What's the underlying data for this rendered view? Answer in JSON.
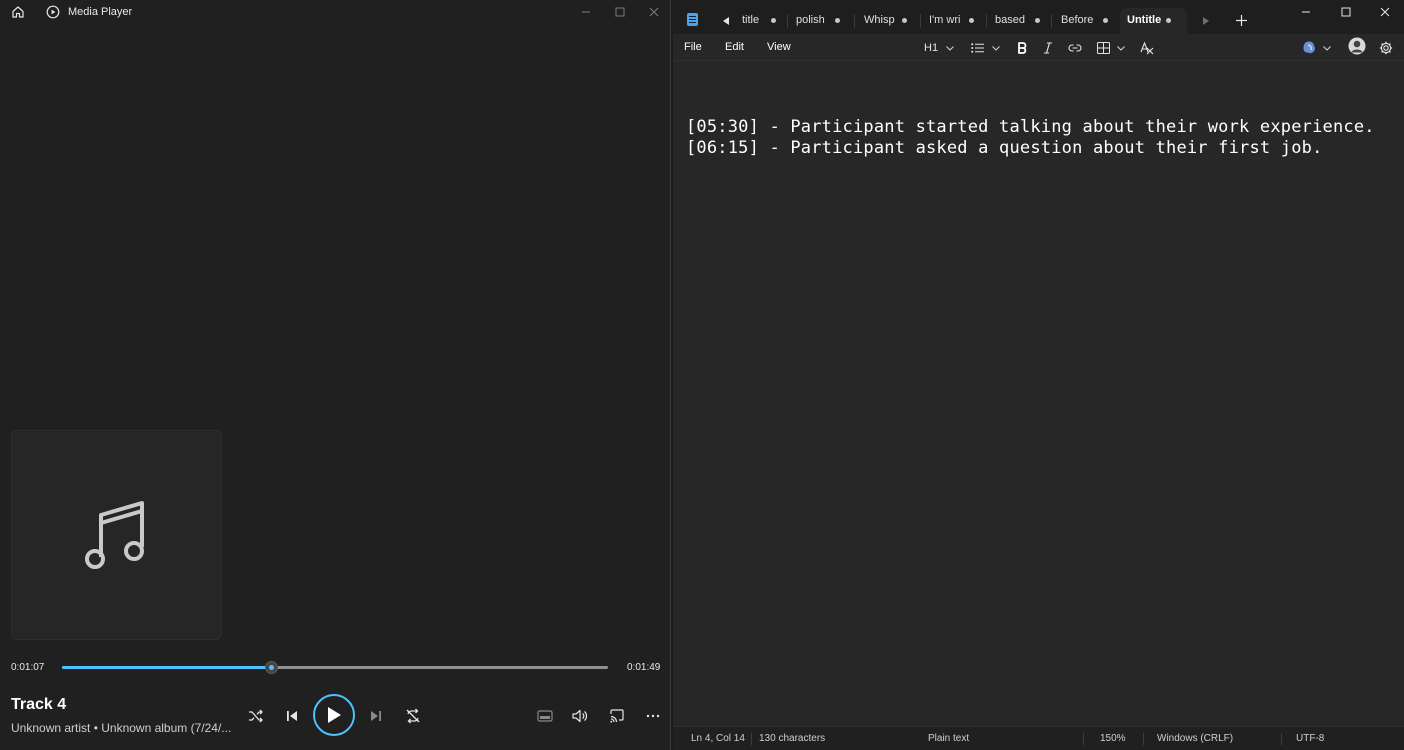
{
  "media_player": {
    "app_name": "Media Player",
    "track": {
      "title": "Track 4",
      "subtitle": "Unknown artist • Unknown album (7/24/..."
    },
    "time_current": "0:01:07",
    "time_total": "0:01:49",
    "progress_fraction": 0.383,
    "accent_color": "#4cc2ff"
  },
  "notepad": {
    "tabs": [
      {
        "label": "title"
      },
      {
        "label": "polish"
      },
      {
        "label": "Whisp"
      },
      {
        "label": "I'm wri"
      },
      {
        "label": "based"
      },
      {
        "label": "Before"
      },
      {
        "label": "Untitle"
      }
    ],
    "active_tab_index": 6,
    "menu": {
      "file": "File",
      "edit": "Edit",
      "view": "View"
    },
    "toolbar": {
      "heading_label": "H1"
    },
    "content_lines": [
      "[05:30] - Participant started talking about their work experience.",
      "[06:15] - Participant asked a question about their first job."
    ],
    "status": {
      "position": "Ln 4, Col 14",
      "characters": "130 characters",
      "format": "Plain text",
      "zoom": "150%",
      "line_ending": "Windows (CRLF)",
      "encoding": "UTF-8"
    }
  }
}
